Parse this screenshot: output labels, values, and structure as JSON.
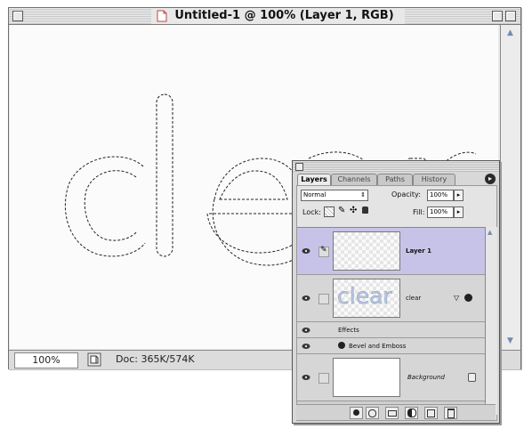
{
  "window": {
    "title": "Untitled-1 @ 100% (Layer 1, RGB)",
    "zoom": "100%",
    "doc_info": "Doc: 365K/574K"
  },
  "canvas": {
    "selection_text": "clear"
  },
  "layers_palette": {
    "tabs": [
      "Layers",
      "Channels",
      "Paths",
      "History"
    ],
    "active_tab": "Layers",
    "blend_mode": "Normal",
    "opacity_label": "Opacity:",
    "opacity_value": "100%",
    "lock_label": "Lock:",
    "fill_label": "Fill:",
    "fill_value": "100%",
    "layers": [
      {
        "name": "Layer 1",
        "selected": true
      },
      {
        "name": "clear",
        "thumb_text": "clear",
        "effects_label": "Effects",
        "effect_name": "Bevel and Emboss"
      },
      {
        "name": "Background",
        "locked": true
      }
    ],
    "bottom_icons": [
      "layer-style-icon",
      "layer-mask-icon",
      "new-set-icon",
      "adjustment-layer-icon",
      "new-layer-icon",
      "trash-icon"
    ]
  },
  "colors": {
    "selected_row": "#c7c3e8",
    "thumb_text": "#b8c4de"
  }
}
